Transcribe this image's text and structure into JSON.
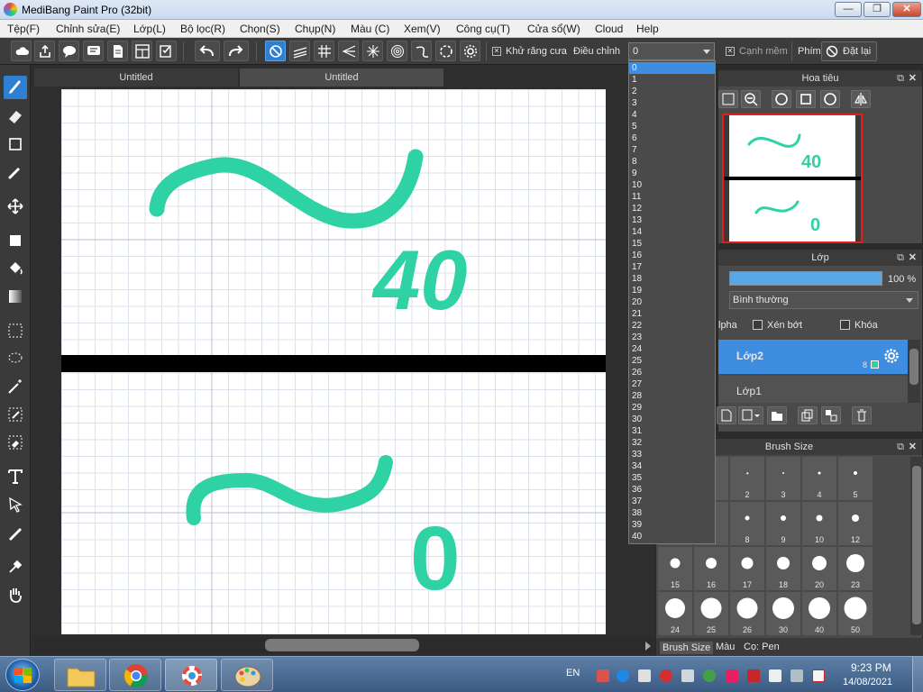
{
  "window": {
    "title": "MediBang Paint Pro (32bit)",
    "minimize": "—",
    "maximize": "❐",
    "close": "✕"
  },
  "menu": [
    "Tệp(F)",
    "Chỉnh sửa(E)",
    "Lớp(L)",
    "Bộ lọc(R)",
    "Chọn(S)",
    "Chụp(N)",
    "Màu (C)",
    "Xem(V)",
    "Công cụ(T)",
    "Cửa sổ(W)",
    "Cloud",
    "Help"
  ],
  "toolbar": {
    "antialias_label": "Khử răng cưa",
    "correction_label": "Điều chỉnh",
    "correction_value": "0",
    "soft_edge_label": "Cạnh mềm",
    "key_label": "Phím",
    "reset_label": "Đặt lại"
  },
  "tabs": [
    "Untitled",
    "Untitled"
  ],
  "canvas": {
    "strokes": [
      "~ 40",
      "~ 0"
    ],
    "stroke_color": "#2fd2a4",
    "text_top": "40",
    "text_bottom": "0"
  },
  "navigator": {
    "title": "Hoa tiêu",
    "preview_top": "40",
    "preview_bottom": "0"
  },
  "layers": {
    "title": "Lớp",
    "opacity": "100 %",
    "opacity_fraction": 1.0,
    "blend_mode": "Bình thường",
    "alpha_label": "lpha",
    "clip_label": "Xén bớt",
    "lock_label": "Khóa",
    "items": [
      {
        "name": "Lớp2",
        "number": "8",
        "selected": true
      },
      {
        "name": "Lớp1",
        "number": "8",
        "selected": false
      }
    ]
  },
  "brush_size": {
    "title": "Brush Size",
    "sizes": [
      "",
      "2",
      "3",
      "4",
      "5",
      "",
      "8",
      "9",
      "10",
      "12",
      "15",
      "16",
      "17",
      "18",
      "20",
      "23",
      "24",
      "25",
      "26",
      "30",
      "40",
      "50"
    ],
    "tabs": [
      "Brush Size",
      "Màu",
      "Cọ: Pen"
    ]
  },
  "dropdown": {
    "options": [
      "0",
      "1",
      "2",
      "3",
      "4",
      "5",
      "6",
      "7",
      "8",
      "9",
      "10",
      "11",
      "12",
      "13",
      "14",
      "15",
      "16",
      "17",
      "18",
      "19",
      "20",
      "21",
      "22",
      "23",
      "24",
      "25",
      "26",
      "27",
      "28",
      "29",
      "30",
      "31",
      "32",
      "33",
      "34",
      "35",
      "36",
      "37",
      "38",
      "39",
      "40"
    ],
    "selected": "0"
  },
  "taskbar": {
    "lang": "EN",
    "time": "9:23 PM",
    "date": "14/08/2021"
  },
  "colors": {
    "accent": "#2f7fd3",
    "stroke": "#2fd2a4",
    "layer_selected": "#3d8de0"
  }
}
